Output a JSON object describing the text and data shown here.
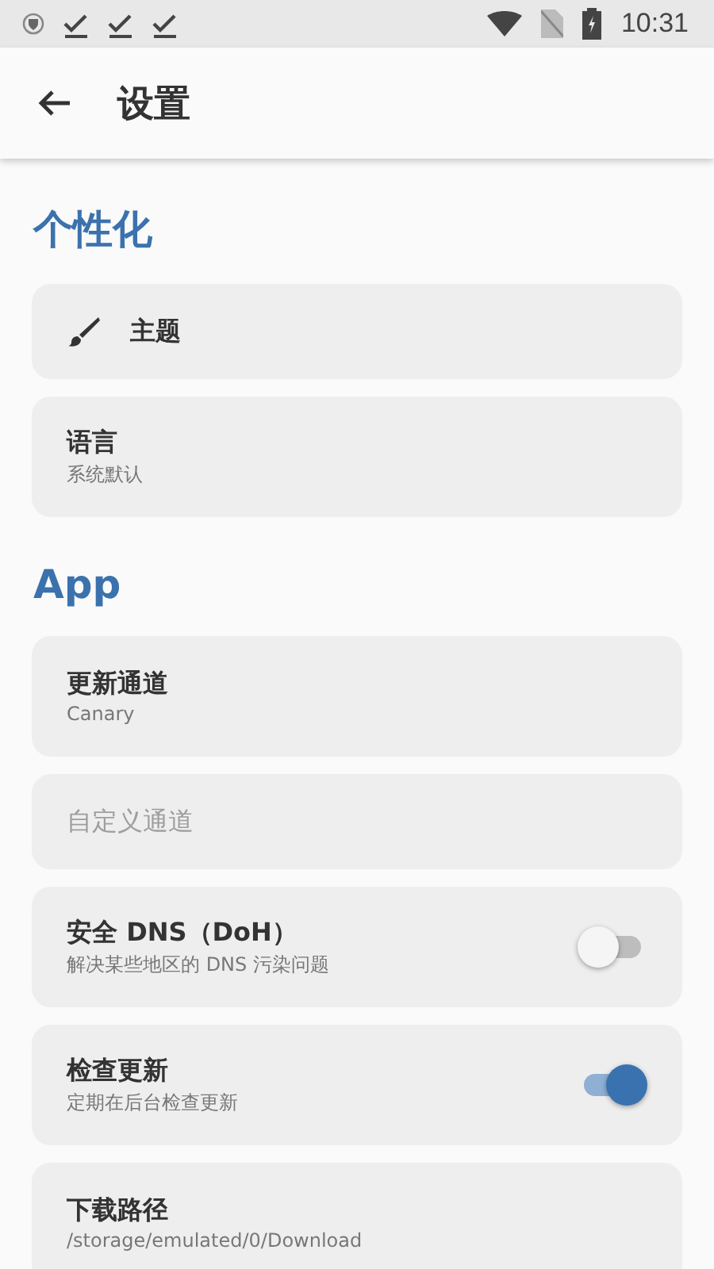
{
  "status_bar": {
    "time": "10:31"
  },
  "app_bar": {
    "title": "设置"
  },
  "sections": [
    {
      "title": "个性化",
      "items": [
        {
          "kind": "icon",
          "title": "主题",
          "disabled": false
        },
        {
          "kind": "plain",
          "title": "语言",
          "subtitle": "系统默认",
          "disabled": false
        }
      ]
    },
    {
      "title": "App",
      "items": [
        {
          "kind": "plain",
          "title": "更新通道",
          "subtitle": "Canary",
          "disabled": false
        },
        {
          "kind": "plain",
          "title": "自定义通道",
          "disabled": true
        },
        {
          "kind": "switch",
          "title": "安全 DNS（DoH）",
          "subtitle": "解决某些地区的 DNS 污染问题",
          "disabled": false,
          "on": false
        },
        {
          "kind": "switch",
          "title": "检查更新",
          "subtitle": "定期在后台检查更新",
          "disabled": false,
          "on": true
        },
        {
          "kind": "plain",
          "title": "下载路径",
          "subtitle": "/storage/emulated/0/Download",
          "disabled": false
        }
      ]
    }
  ]
}
